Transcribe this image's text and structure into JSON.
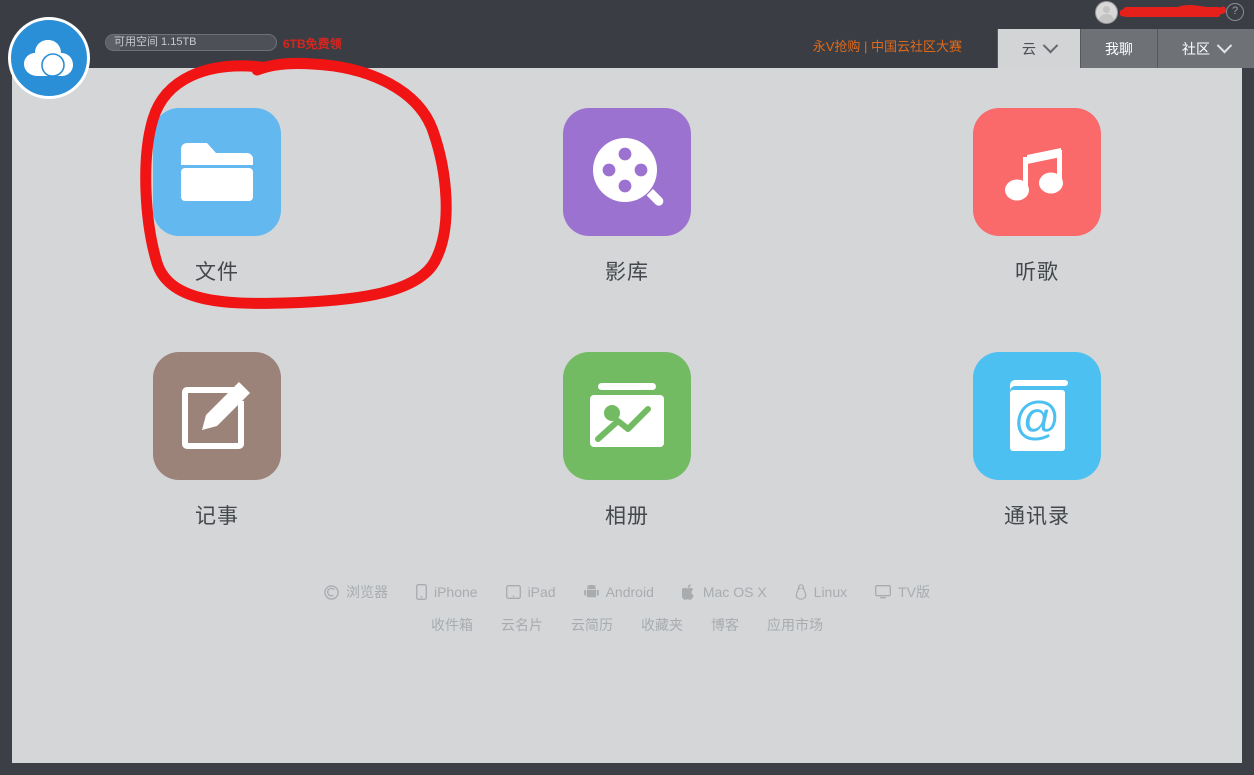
{
  "window": {
    "frame_color": "#3c4046",
    "header_color": "#3a3e44",
    "surface_color": "#d4d6d8"
  },
  "header": {
    "logo_icon": "cloud-logo-icon",
    "logo_color": "#2b8fd8",
    "storage": {
      "label": "可用空间 1.15TB",
      "promo_label": "6TB免费领",
      "promo_color": "#d8251f",
      "used_percent": 8
    },
    "promo_link": "永V抢购 | 中国云社区大赛",
    "promo_link_color": "#e0691a",
    "account": {
      "avatar_icon": "user-avatar-icon",
      "username": "",
      "username_redacted": true,
      "help_icon": "help-question-icon"
    },
    "tabs": [
      {
        "label": "云",
        "active": true,
        "has_caret": true
      },
      {
        "label": "我聊",
        "active": false,
        "has_caret": false
      },
      {
        "label": "社区",
        "active": false,
        "has_caret": true
      }
    ]
  },
  "apps": [
    {
      "label": "文件",
      "icon": "folder-icon",
      "color": "#63b8f0",
      "name": "files"
    },
    {
      "label": "影库",
      "icon": "film-reel-icon",
      "color": "#9b72cf",
      "name": "videos"
    },
    {
      "label": "听歌",
      "icon": "music-note-icon",
      "color": "#fa6a6a",
      "name": "music"
    },
    {
      "label": "记事",
      "icon": "note-edit-icon",
      "color": "#9c8379",
      "name": "notes"
    },
    {
      "label": "相册",
      "icon": "photo-album-icon",
      "color": "#73bb62",
      "name": "photos"
    },
    {
      "label": "通讯录",
      "icon": "contacts-at-icon",
      "color": "#4dc0f2",
      "name": "contacts"
    }
  ],
  "footer": {
    "platforms": [
      {
        "label": "浏览器",
        "icon": "browser-icon"
      },
      {
        "label": "iPhone",
        "icon": "iphone-icon"
      },
      {
        "label": "iPad",
        "icon": "ipad-icon"
      },
      {
        "label": "Android",
        "icon": "android-icon"
      },
      {
        "label": "Mac OS X",
        "icon": "apple-icon"
      },
      {
        "label": "Linux",
        "icon": "linux-penguin-icon"
      },
      {
        "label": "TV版",
        "icon": "tv-icon"
      }
    ],
    "links": [
      "收件箱",
      "云名片",
      "云简历",
      "收藏夹",
      "博客",
      "应用市场"
    ]
  },
  "annotation": {
    "shape": "hand-drawn-circle",
    "color": "#f01414",
    "target": "文件"
  }
}
